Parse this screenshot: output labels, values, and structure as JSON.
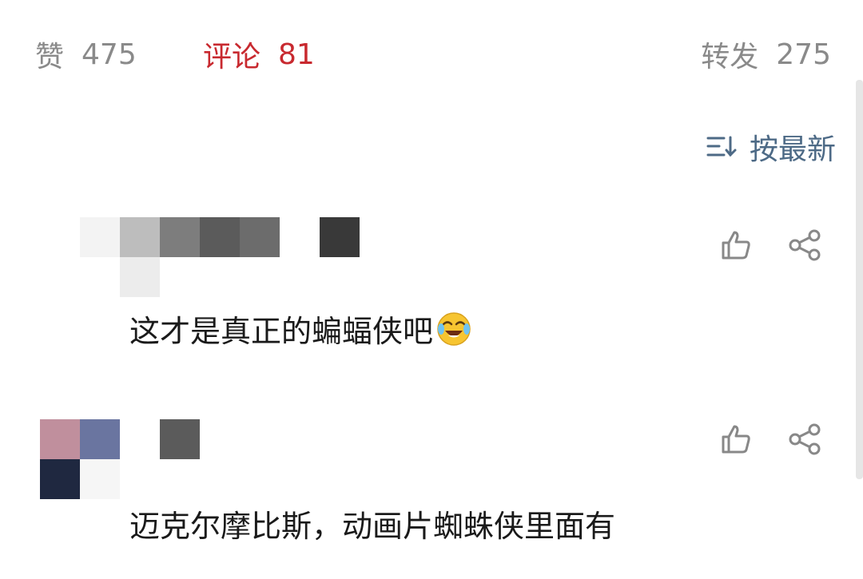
{
  "stats": {
    "likes": {
      "label": "赞",
      "count": "475"
    },
    "comments": {
      "label": "评论",
      "count": "81"
    },
    "reposts": {
      "label": "转发",
      "count": "275"
    }
  },
  "sort": {
    "label": "按最新",
    "icon": "sort-icon"
  },
  "comments": [
    {
      "text": "这才是真正的蝙蝠侠吧",
      "emoji": "laughing-crying-emoji",
      "actions": [
        "thumbs-up-icon",
        "share-icon"
      ]
    },
    {
      "text": "迈克尔摩比斯，动画片蜘蛛侠里面有",
      "actions": [
        "thumbs-up-icon",
        "share-icon"
      ]
    }
  ],
  "colors": {
    "active_tab": "#c8292f",
    "muted_text": "#8a8a8a",
    "sort_link": "#4d6a86",
    "icon_gray": "#888888"
  }
}
